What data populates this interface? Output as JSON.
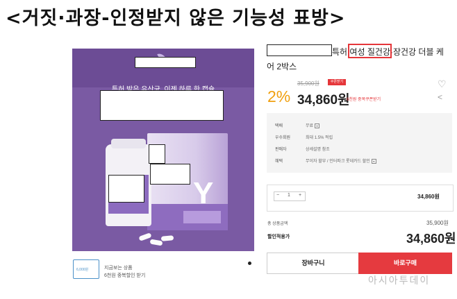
{
  "headline": "<거짓·과장-인정받지 않은 기능성 표방>",
  "breadcrumb": "",
  "hero": {
    "subtitle": "특허 받은 유산균, 이젠 하루 한 캡슐",
    "box_letter": "Y"
  },
  "promo": {
    "amount": "6,000원",
    "line1": "지금보는 상품",
    "line2": "6천원 중복할인 받기"
  },
  "product": {
    "title_line1_suffix": "특허 여성 질건강·장건강 더블 케",
    "title_line2": "어 2박스",
    "coupon_badge": "쿠폰받기",
    "original_price": "35,900원",
    "discount_rate": "2%",
    "price": "34,860원",
    "coupon_link": "6천원 중복쿠폰받기"
  },
  "info": {
    "rows": [
      {
        "label": "택배",
        "value": "무료"
      },
      {
        "label": "우수회원",
        "value": "최대 1.5% 적립"
      },
      {
        "label": "판매자",
        "value": "상세설명 참조"
      },
      {
        "label": "혜택",
        "value": "무이자 할부 / 인터파크 롯데카드 할인"
      }
    ]
  },
  "quantity": {
    "minus": "−",
    "value": "1",
    "plus": "+",
    "line_price": "34,860원"
  },
  "summary": {
    "total_label": "총 상품금액",
    "total_value": "35,900원",
    "discount_label": "할인적용가",
    "discount_value": "34,860원"
  },
  "buttons": {
    "cart": "장바구니",
    "buy": "바로구매"
  },
  "watermark": "아시아투데이",
  "colors": {
    "accent_red": "#e5363a",
    "discount_orange": "#f0a010",
    "hero_purple": "#7a5aa3"
  }
}
